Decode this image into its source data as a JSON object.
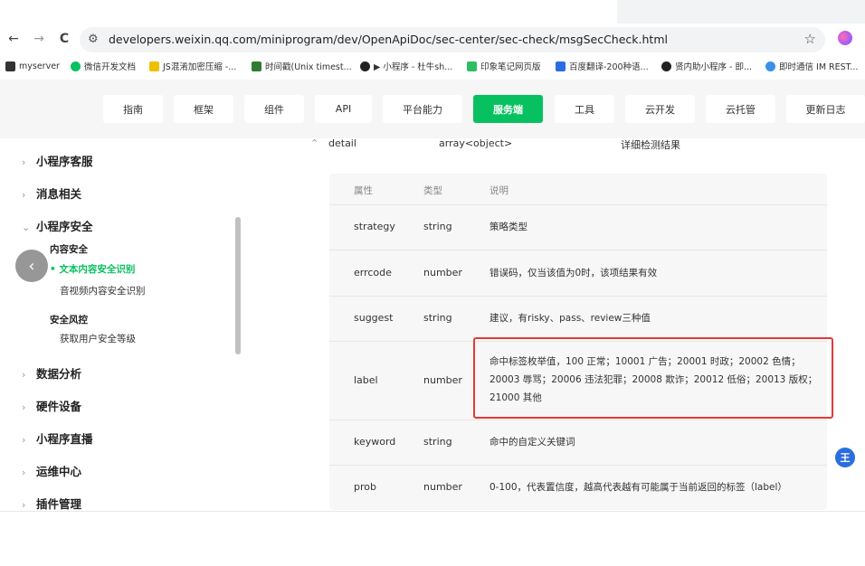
{
  "browser": {
    "url": "developers.weixin.qq.com/miniprogram/dev/OpenApiDoc/sec-center/sec-check/msgSecCheck.html",
    "back": "←",
    "forward": "→",
    "reload": "C",
    "star": "☆"
  },
  "bookmarks": [
    {
      "label": "myserver",
      "color": "#333"
    },
    {
      "label": "微信开发文档",
      "color": "#07c160"
    },
    {
      "label": "JS混淆加密压缩 -...",
      "color": "#f0c000"
    },
    {
      "label": "时间戳(Unix timest...",
      "color": "#2e7d32"
    },
    {
      "label": "▶ 小程序 - 杜牛sh...",
      "color": "#222"
    },
    {
      "label": "印象笔记网页版",
      "color": "#2dbe60"
    },
    {
      "label": "百度翻译-200种语...",
      "color": "#2b6de0"
    },
    {
      "label": "贤内助小程序 - 即...",
      "color": "#222"
    },
    {
      "label": "即时通信 IM REST...",
      "color": "#3b8eea"
    }
  ],
  "topnav": [
    "指南",
    "框架",
    "组件",
    "API",
    "平台能力",
    "服务端",
    "工具",
    "云开发",
    "云托管",
    "更新日志"
  ],
  "topnav_active": "服务端",
  "sidebar": {
    "items": [
      {
        "label": "小程序客服",
        "chev": "›"
      },
      {
        "label": "消息相关",
        "chev": "›"
      },
      {
        "label": "小程序安全",
        "chev": "⌄"
      },
      {
        "label": "数据分析",
        "chev": "›"
      },
      {
        "label": "硬件设备",
        "chev": "›"
      },
      {
        "label": "小程序直播",
        "chev": "›"
      },
      {
        "label": "运维中心",
        "chev": "›"
      },
      {
        "label": "插件管理",
        "chev": "›"
      }
    ],
    "group1": "内容安全",
    "active": "• 文本内容安全识别",
    "link1": "音视频内容安全识别",
    "group2": "安全风控",
    "link2": "获取用户安全等级"
  },
  "detail": {
    "toggle": "⌃",
    "name": "detail",
    "type": "array<object>",
    "desc": "详细检测结果"
  },
  "table": {
    "headers": [
      "属性",
      "类型",
      "说明"
    ],
    "rows": [
      {
        "name": "strategy",
        "type": "string",
        "desc": "策略类型"
      },
      {
        "name": "errcode",
        "type": "number",
        "desc": "错误码，仅当该值为0时，该项结果有效"
      },
      {
        "name": "suggest",
        "type": "string",
        "desc": "建议，有risky、pass、review三种值"
      },
      {
        "name": "label",
        "type": "number",
        "desc": "命中标签枚举值，100 正常；10001 广告；20001 时政；20002 色情；20003 辱骂；20006 违法犯罪；20008 欺诈；20012 低俗；20013 版权；21000 其他"
      },
      {
        "name": "keyword",
        "type": "string",
        "desc": "命中的自定义关键词"
      },
      {
        "name": "prob",
        "type": "number",
        "desc": "0-100，代表置信度，越高代表越有可能属于当前返回的标签（label）"
      }
    ]
  },
  "float_badge": "王"
}
